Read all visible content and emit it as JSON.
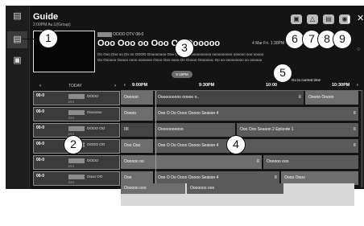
{
  "header": {
    "title": "Guide",
    "time": "2:00PM  Au.U(Group)",
    "close_label": "✕"
  },
  "current": {
    "channel_label": "OOOO DTV 08-0",
    "program_title": "Ooo Ooo oo Ooo Oo Oooooo",
    "date": "4 Mar Fri. 1:30PM -",
    "desc_line1": "Oo Ooo Ooo oo Oo oo OOOO Ooooooooo Ooo Ooooooo oooooooooo oooooooooo oooooo ooo ooooo",
    "desc_line2": "Oo Oooooo Ooooo oooo ooooooo Oooo Ooo oooo Oo Ooooo Ooooooo, Oo oo ooooooooo oo oooooo"
  },
  "nav": {
    "today": "TODAY",
    "prev": "‹",
    "next": "›",
    "now_pill": "9:15PM",
    "goto": "Go to current time",
    "times": [
      "9:00PM",
      "9:30PM",
      "10:00",
      "10:30PM"
    ]
  },
  "channels": [
    {
      "num": "00-0",
      "sub": "",
      "label": "OOOO",
      "desc": "DTV"
    },
    {
      "num": "00-0",
      "sub": "",
      "label": "Ooooooo",
      "desc": "DTV"
    },
    {
      "num": "00-0",
      "sub": "",
      "label": "OOOO OO",
      "desc": "DTV"
    },
    {
      "num": "00-0",
      "sub": "",
      "label": "OOOO OO",
      "desc": "DTV"
    },
    {
      "num": "00-0",
      "sub": "",
      "label": "OOOO",
      "desc": "DTV"
    },
    {
      "num": "00-0",
      "sub": "",
      "label": "Oooo OO",
      "desc": "DTV"
    },
    {
      "num": "00-0",
      "sub": "",
      "label": "OOSOOOO",
      "desc": "DTV"
    }
  ],
  "programs": [
    [
      {
        "t": "Oooooo"
      },
      {
        "t": "Oooooooooo ooooo o.."
      },
      {
        "t": "Ooooo Ooooo"
      }
    ],
    [
      {
        "t": "Ooooo"
      },
      {
        "t": "Ooo O Oo Oooo Ooooo Season 4"
      }
    ],
    [
      {
        "t": "00"
      },
      {
        "t": "Ooooooooooo"
      },
      {
        "t": "Ooo Ooo Season 2 Episode 1"
      }
    ],
    [
      {
        "t": "Ooo Ooo"
      },
      {
        "t": "Ooo O Oo Oooo Ooooo Season 4"
      }
    ],
    [
      {
        "t": "Oooooo oo"
      },
      {
        "t": "Oooooo ooo"
      }
    ],
    [
      {
        "t": "Ooo"
      },
      {
        "t": "Ooo O Oo Oooo Ooooo Season 4"
      },
      {
        "t": "Oooo Oooo"
      }
    ],
    [
      {
        "t": "Oooooo ooo"
      },
      {
        "t": "Ooooooo ooo"
      }
    ]
  ],
  "callouts": [
    "1",
    "2",
    "3",
    "4",
    "5",
    "6",
    "7",
    "8",
    "9"
  ],
  "icons": {
    "left": [
      "guide-icon",
      "list-icon",
      "schedule-icon"
    ],
    "top": [
      "record-icon",
      "filter-icon",
      "favorite-icon",
      "settings-icon"
    ]
  },
  "colors": {
    "background": "#141414",
    "cell": "#5a5a5a",
    "channel": "#3b3b3b"
  }
}
